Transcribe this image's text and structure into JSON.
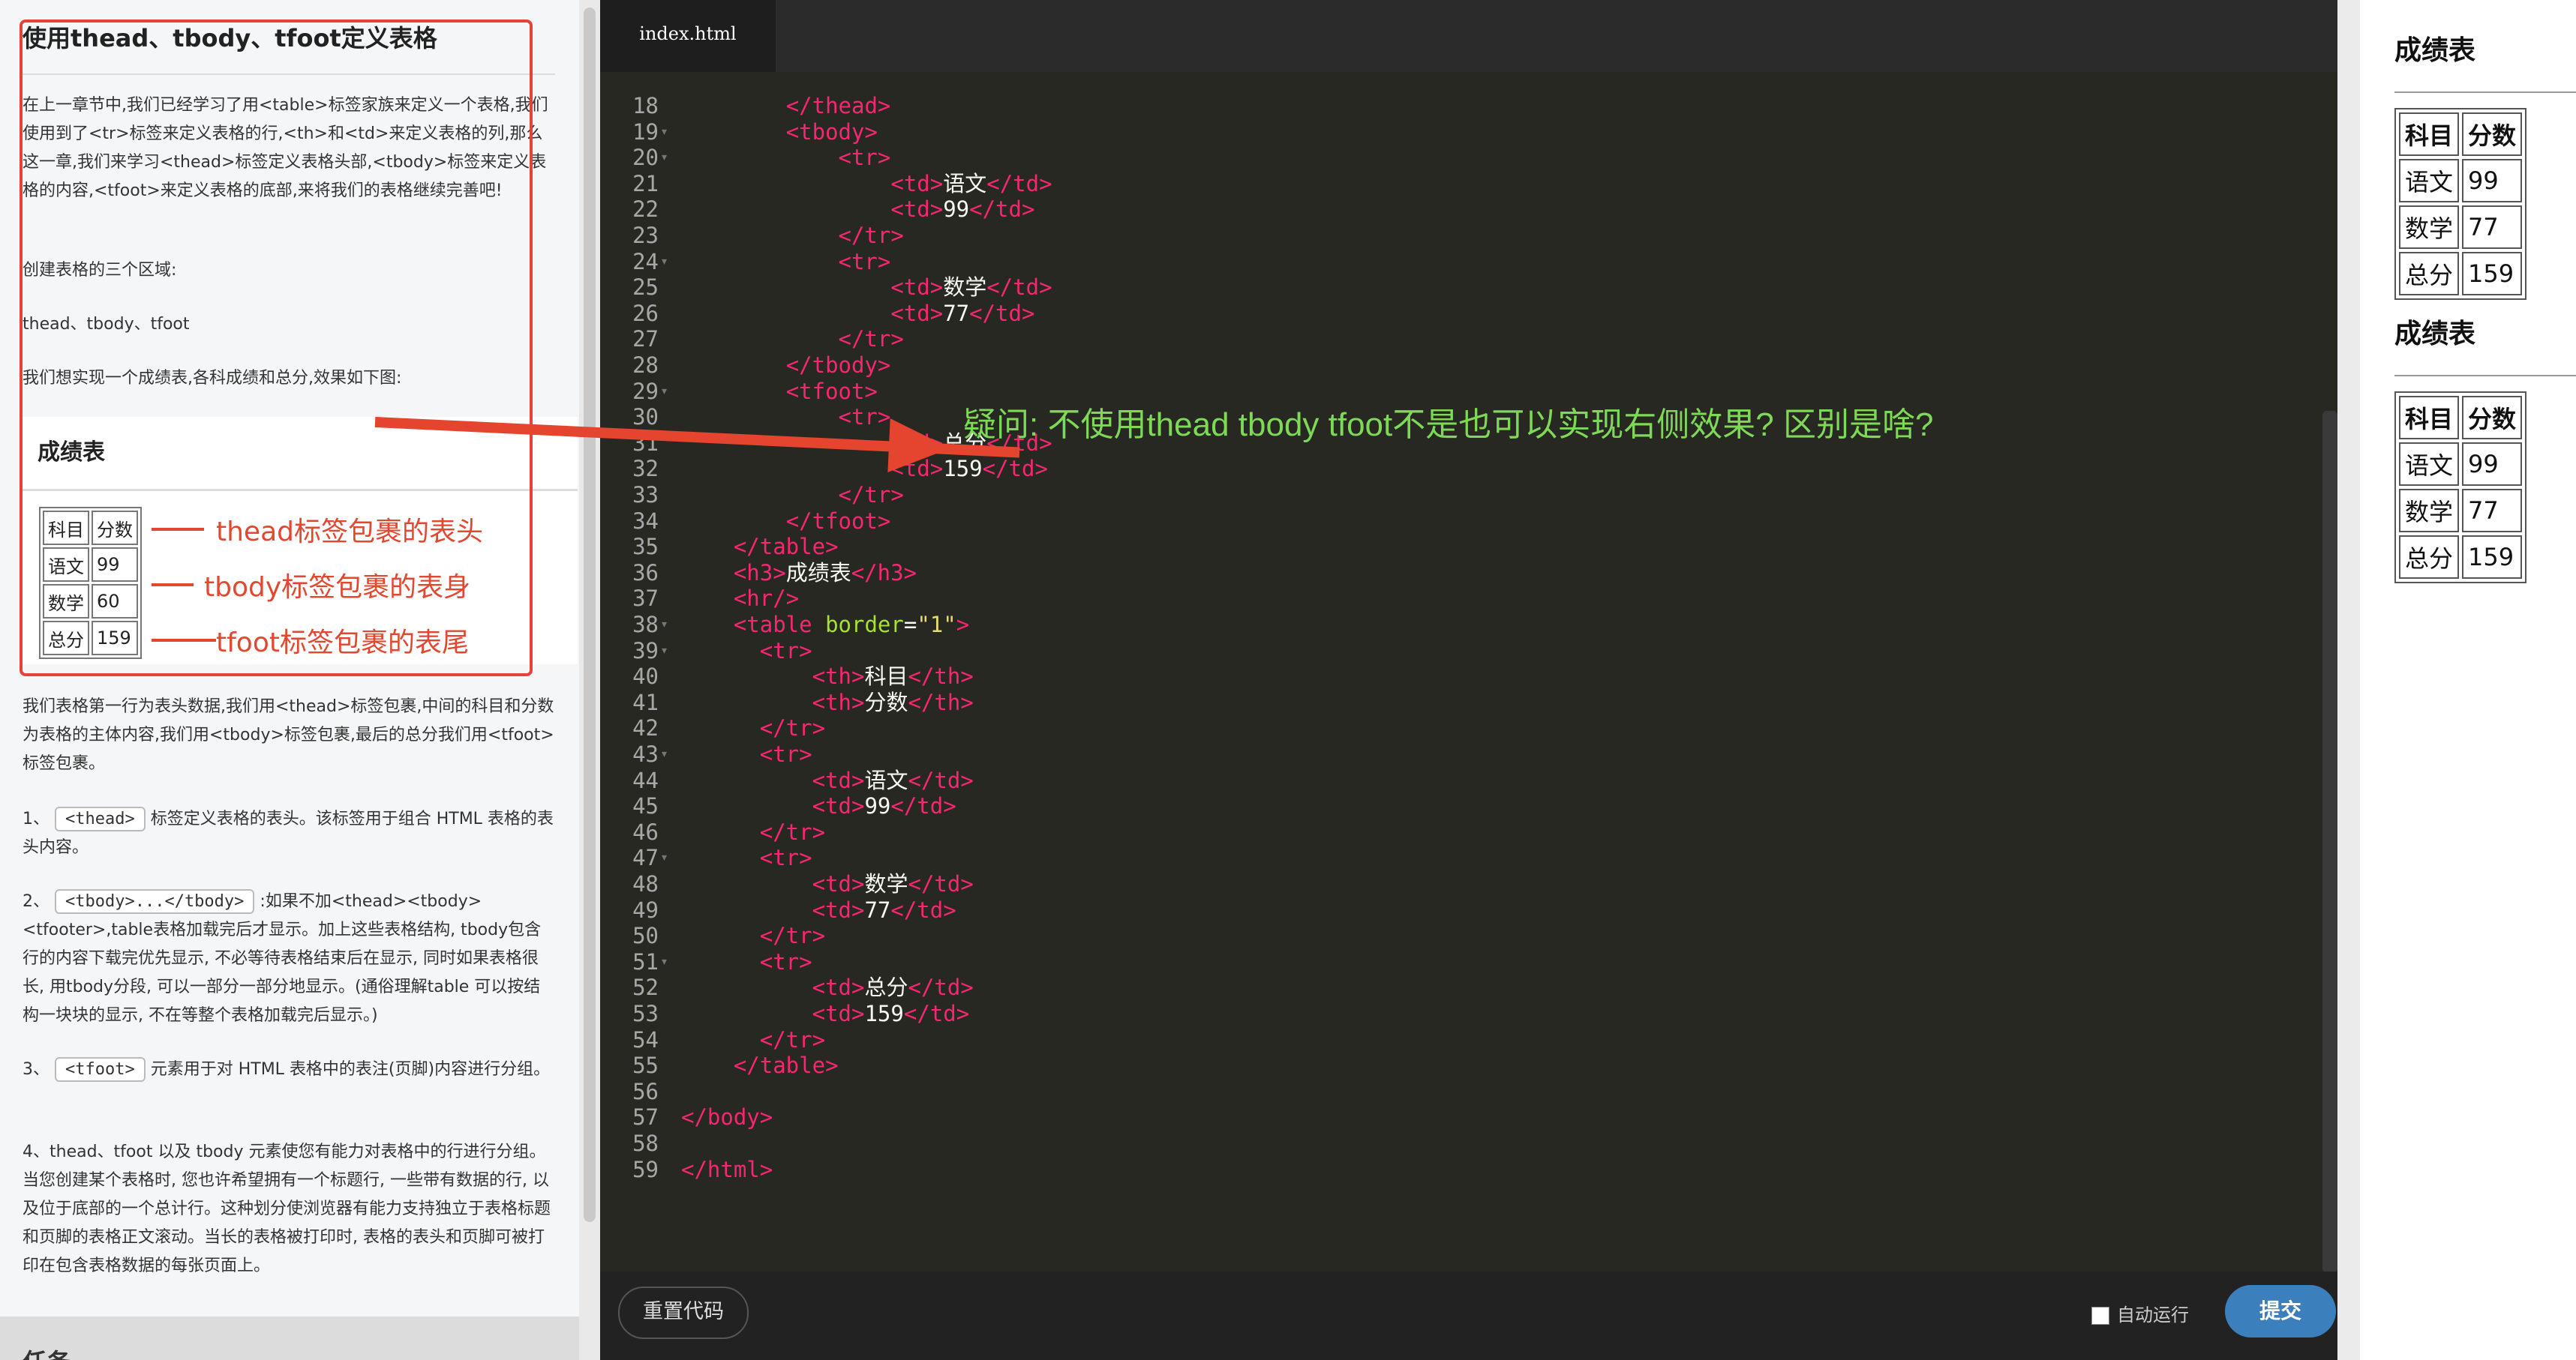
{
  "lesson": {
    "title": "使用thead、tbody、tfoot定义表格",
    "para1": "在上一章节中,我们已经学习了用<table>标签家族来定义一个表格,我们使用到了<tr>标签来定义表格的行,<th>和<td>来定义表格的列,那么这一章,我们来学习<thead>标签定义表格头部,<tbody>标签来定义表格的内容,<tfoot>来定义表格的底部,来将我们的表格继续完善吧!",
    "para2": "创建表格的三个区域:",
    "para3": "thead、tbody、tfoot",
    "para4": "我们想实现一个成绩表,各科成绩和总分,效果如下图:",
    "image_title": "成绩表",
    "image_table": [
      [
        "科目",
        "分数"
      ],
      [
        "语文",
        "99"
      ],
      [
        "数学",
        "60"
      ],
      [
        "总分",
        "159"
      ]
    ],
    "ann1": "thead标签包裹的表头",
    "ann2": "tbody标签包裹的表身",
    "ann3": "tfoot标签包裹的表尾",
    "para5": "我们表格第一行为表头数据,我们用<thead>标签包裹,中间的科目和分数为表格的主体内容,我们用<tbody>标签包裹,最后的总分我们用<tfoot>标签包裹。",
    "item1_num": "1、",
    "item1_code": "<thead>",
    "item1_text": "标签定义表格的表头。该标签用于组合 HTML 表格的表头内容。",
    "item2_num": "2、",
    "item2_code": "<tbody>...</tbody>",
    "item2_text": ":如果不加<thead><tbody><tfooter>,table表格加载完后才显示。加上这些表格结构, tbody包含行的内容下载完优先显示, 不必等待表格结束后在显示, 同时如果表格很长, 用tbody分段, 可以一部分一部分地显示。(通俗理解table 可以按结构一块块的显示, 不在等整个表格加载完后显示。)",
    "item3_num": "3、",
    "item3_code": "<tfoot>",
    "item3_text": "元素用于对 HTML 表格中的表注(页脚)内容进行分组。",
    "item4_text": "4、thead、tfoot 以及 tbody 元素使您有能力对表格中的行进行分组。当您创建某个表格时, 您也许希望拥有一个标题行, 一些带有数据的行, 以及位于底部的一个总计行。这种划分使浏览器有能力支持独立于表格标题和页脚的表格正文滚动。当长的表格被打印时, 表格的表头和页脚可被打印在包含表格数据的每张页面上。",
    "task_label": "任务"
  },
  "editor": {
    "tab": "index.html",
    "question": "疑问: 不使用thead tbody tfoot不是也可以实现右侧效果? 区别是啥?",
    "reset_label": "重置代码",
    "autorun_label": "自动运行",
    "submit_label": "提交",
    "lines": [
      {
        "n": "18",
        "src": "        </thead>"
      },
      {
        "n": "19",
        "src": "        <tbody>"
      },
      {
        "n": "20",
        "src": "            <tr>"
      },
      {
        "n": "21",
        "src": "                <td>语文</td>"
      },
      {
        "n": "22",
        "src": "                <td>99</td>"
      },
      {
        "n": "23",
        "src": "            </tr>"
      },
      {
        "n": "24",
        "src": "            <tr>"
      },
      {
        "n": "25",
        "src": "                <td>数学</td>"
      },
      {
        "n": "26",
        "src": "                <td>77</td>"
      },
      {
        "n": "27",
        "src": "            </tr>"
      },
      {
        "n": "28",
        "src": "        </tbody>"
      },
      {
        "n": "29",
        "src": "        <tfoot>"
      },
      {
        "n": "30",
        "src": "            <tr>"
      },
      {
        "n": "31",
        "src": "                <td>总分</td>"
      },
      {
        "n": "32",
        "src": "                <td>159</td>"
      },
      {
        "n": "33",
        "src": "            </tr>"
      },
      {
        "n": "34",
        "src": "        </tfoot>"
      },
      {
        "n": "35",
        "src": "    </table>"
      },
      {
        "n": "36",
        "src": "    <h3>成绩表</h3>"
      },
      {
        "n": "37",
        "src": "    <hr/>"
      },
      {
        "n": "38",
        "src": "    <table border=\"1\">"
      },
      {
        "n": "39",
        "src": "      <tr>"
      },
      {
        "n": "40",
        "src": "          <th>科目</th>"
      },
      {
        "n": "41",
        "src": "          <th>分数</th>"
      },
      {
        "n": "42",
        "src": "      </tr>"
      },
      {
        "n": "43",
        "src": "      <tr>"
      },
      {
        "n": "44",
        "src": "          <td>语文</td>"
      },
      {
        "n": "45",
        "src": "          <td>99</td>"
      },
      {
        "n": "46",
        "src": "      </tr>"
      },
      {
        "n": "47",
        "src": "      <tr>"
      },
      {
        "n": "48",
        "src": "          <td>数学</td>"
      },
      {
        "n": "49",
        "src": "          <td>77</td>"
      },
      {
        "n": "50",
        "src": "      </tr>"
      },
      {
        "n": "51",
        "src": "      <tr>"
      },
      {
        "n": "52",
        "src": "          <td>总分</td>"
      },
      {
        "n": "53",
        "src": "          <td>159</td>"
      },
      {
        "n": "54",
        "src": "      </tr>"
      },
      {
        "n": "55",
        "src": "    </table>"
      },
      {
        "n": "56",
        "src": ""
      },
      {
        "n": "57",
        "src": "</body>"
      },
      {
        "n": "58",
        "src": ""
      },
      {
        "n": "59",
        "src": "</html>"
      }
    ]
  },
  "preview": {
    "title1": "成绩表",
    "title2": "成绩表",
    "table1": [
      [
        "科目",
        "分数"
      ],
      [
        "语文",
        "99"
      ],
      [
        "数学",
        "77"
      ],
      [
        "总分",
        "159"
      ]
    ],
    "table2": [
      [
        "科目",
        "分数"
      ],
      [
        "语文",
        "99"
      ],
      [
        "数学",
        "77"
      ],
      [
        "总分",
        "159"
      ]
    ]
  }
}
